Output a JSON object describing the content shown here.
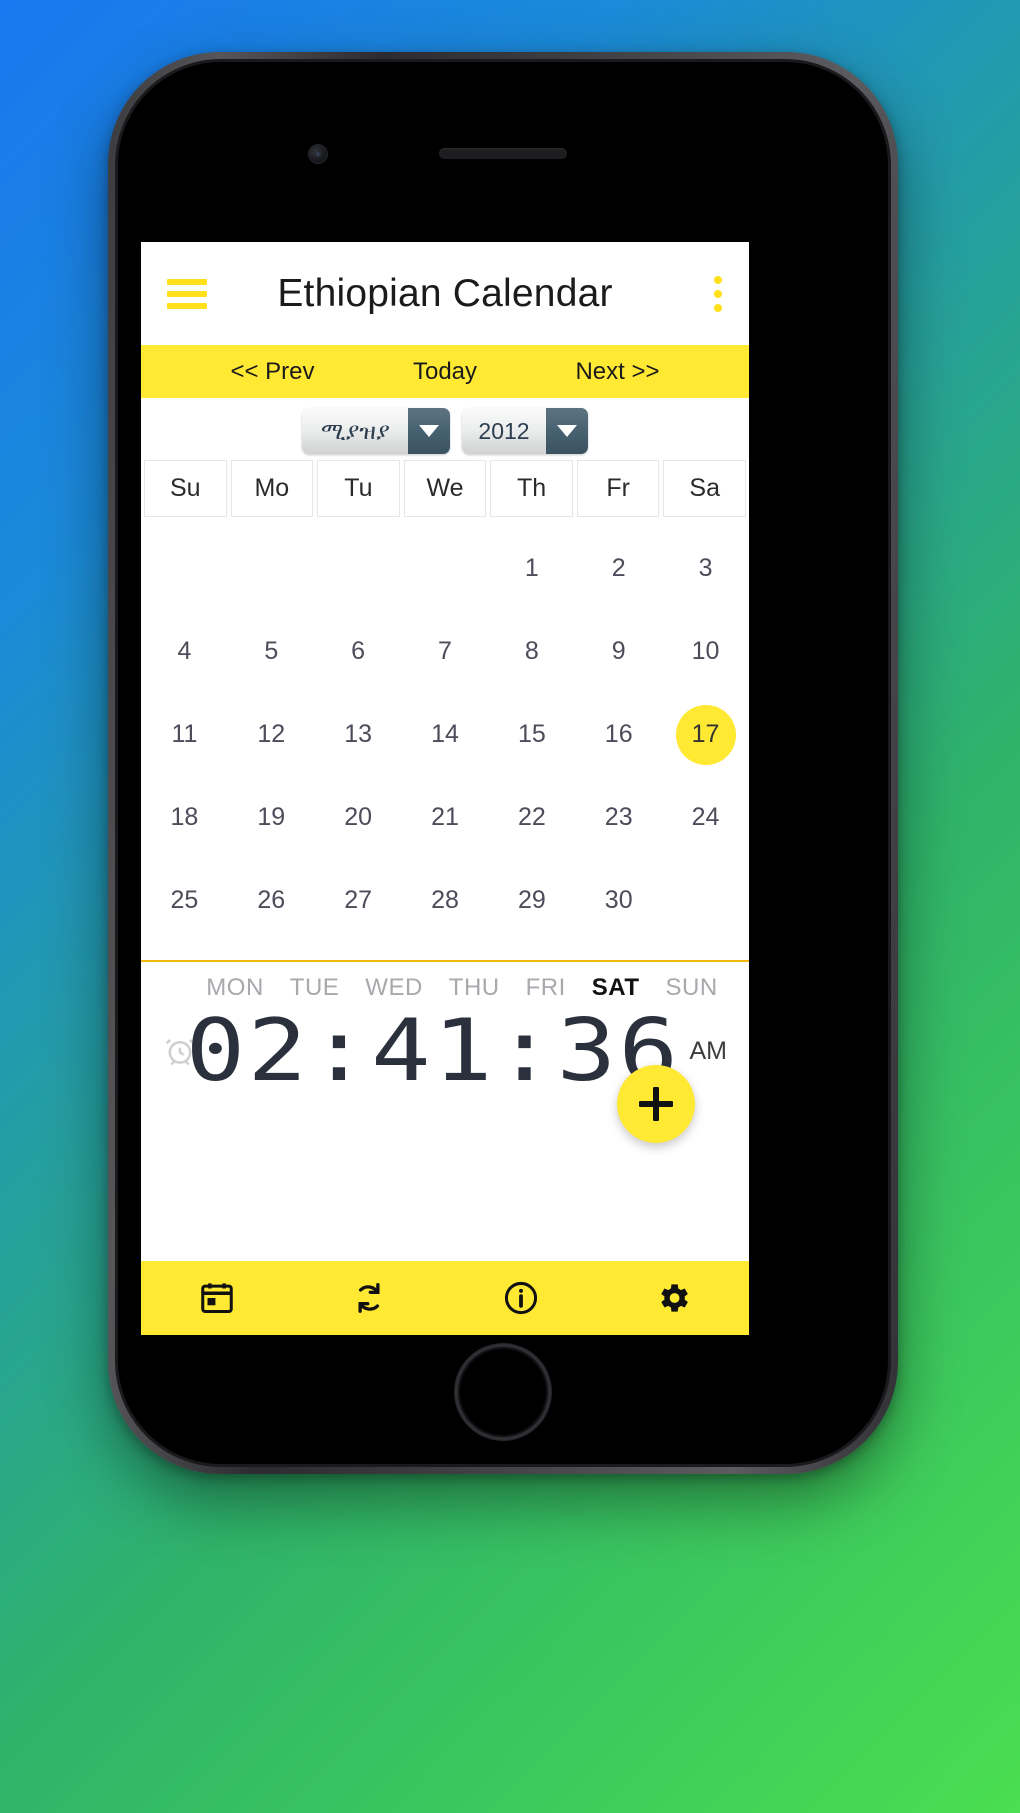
{
  "app": {
    "title": "Ethiopian Calendar",
    "menu_icon": "hamburger-icon",
    "overflow_icon": "vertical-dots-icon",
    "accent_yellow": "#ffe933",
    "divider_yellow": "#f0b90b",
    "day_text_color": "#4c4c5a"
  },
  "nav": {
    "prev_label": "<< Prev",
    "today_label": "Today",
    "next_label": "Next >>"
  },
  "selectors": {
    "month": {
      "value": "ሚያዝያ",
      "arrow_icon": "chevron-down-icon"
    },
    "year": {
      "value": "2012",
      "arrow_icon": "chevron-down-icon"
    }
  },
  "calendar": {
    "weekday_headers": [
      "Su",
      "Mo",
      "Tu",
      "We",
      "Th",
      "Fr",
      "Sa"
    ],
    "leading_blanks": 4,
    "days": [
      1,
      2,
      3,
      4,
      5,
      6,
      7,
      8,
      9,
      10,
      11,
      12,
      13,
      14,
      15,
      16,
      17,
      18,
      19,
      20,
      21,
      22,
      23,
      24,
      25,
      26,
      27,
      28,
      29,
      30
    ],
    "today": 17
  },
  "clock": {
    "weekdays": [
      {
        "label": "MON",
        "active": false
      },
      {
        "label": "TUE",
        "active": false
      },
      {
        "label": "WED",
        "active": false
      },
      {
        "label": "THU",
        "active": false
      },
      {
        "label": "FRI",
        "active": false
      },
      {
        "label": "SAT",
        "active": true
      },
      {
        "label": "SUN",
        "active": false
      }
    ],
    "time": "02:41:36",
    "ampm": "AM",
    "alarm_icon": "alarm-clock-icon"
  },
  "fab": {
    "icon": "plus-icon",
    "label": "+"
  },
  "bottom_bar": {
    "items": [
      {
        "icon": "calendar-icon",
        "name": "tab-calendar"
      },
      {
        "icon": "sync-icon",
        "name": "tab-convert"
      },
      {
        "icon": "info-icon",
        "name": "tab-info"
      },
      {
        "icon": "gear-icon",
        "name": "tab-settings"
      }
    ]
  }
}
